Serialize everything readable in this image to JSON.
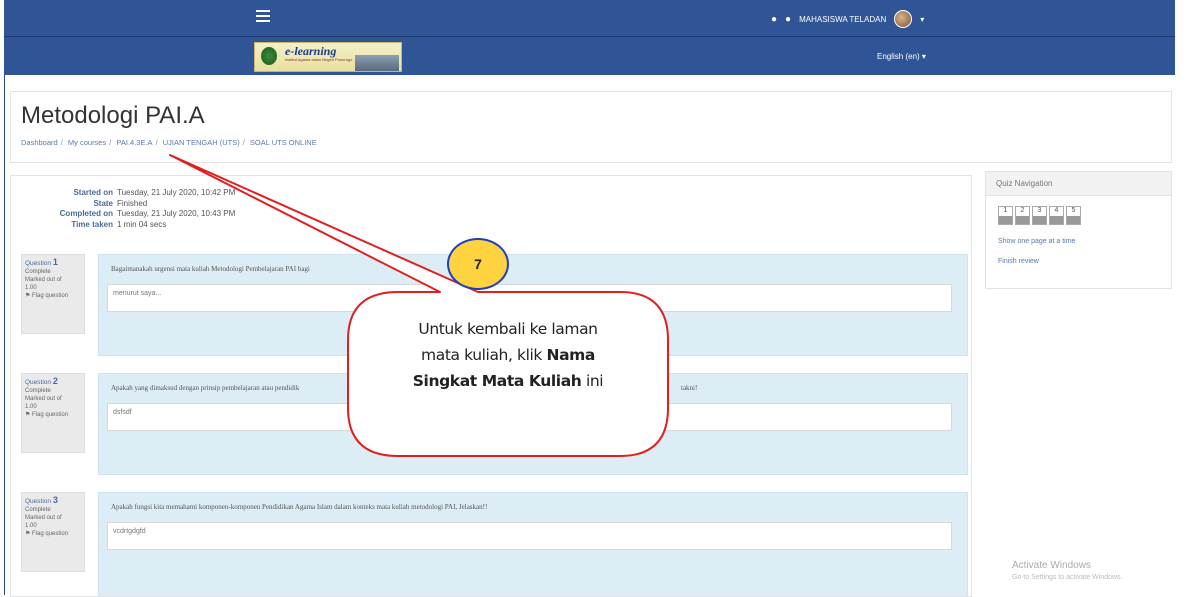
{
  "topbar": {
    "user_name": "MAHASISWA TELADAN",
    "user_caret": "▾",
    "menu_icon": "hamburger-icon",
    "bell_icon": "bell-icon",
    "chat_icon": "chat-icon"
  },
  "banner": {
    "logo_text": "e-learning",
    "logo_subtitle": "Institut Agama Islam Negeri Ponorogo",
    "language": "English (en) ▾"
  },
  "header": {
    "title": "Metodologi PAI.A",
    "breadcrumb": [
      "Dashboard",
      "My courses",
      "PAI.4.3E.A",
      "UJIAN TENGAH (UTS)",
      "SOAL UTS ONLINE"
    ]
  },
  "summary": {
    "rows": [
      {
        "label": "Started on",
        "value": "Tuesday, 21 July 2020, 10:42 PM"
      },
      {
        "label": "State",
        "value": "Finished"
      },
      {
        "label": "Completed on",
        "value": "Tuesday, 21 July 2020, 10:43 PM"
      },
      {
        "label": "Time taken",
        "value": "1 min 04 secs"
      }
    ]
  },
  "questions": [
    {
      "label": "Question",
      "number": "1",
      "status": "Complete",
      "marked": "Marked out of",
      "max": "1.00",
      "flag": "Flag question",
      "text": "Bagaimanakah urgensi mata kuliah Metodologi Pembelajaran PAI bagi",
      "answer": "menurut saya..."
    },
    {
      "label": "Question",
      "number": "2",
      "status": "Complete",
      "marked": "Marked out of",
      "max": "1.00",
      "flag": "Flag question",
      "text": "Apakah yang dimaksud dengan prinsip pembelajaran atau pendidik",
      "text_tail": "takni!",
      "answer": "dsfsdf"
    },
    {
      "label": "Question",
      "number": "3",
      "status": "Complete",
      "marked": "Marked out of",
      "max": "1.00",
      "flag": "Flag question",
      "text": "Apakah fungsi kita memahami komponen-komponen Pendidikan Agama Islam dalam konteks mata kuliah metodologi PAI, Jelaskan!!",
      "answer": "vcdrtgdgfd"
    }
  ],
  "quiz_nav": {
    "title": "Quiz Navigation",
    "buttons": [
      "1",
      "2",
      "3",
      "4",
      "5"
    ],
    "show_one_page": "Show one page at a time",
    "finish_review": "Finish review"
  },
  "callout": {
    "badge": "7",
    "line1": "Untuk kembali ke laman",
    "line2_pre": "mata kuliah, klik ",
    "line2_bold": "Nama",
    "line3_bold": "Singkat Mata Kuliah",
    "line3_post": " ini"
  },
  "watermark": {
    "title": "Activate Windows",
    "subtitle": "Go to Settings to activate Windows."
  },
  "colors": {
    "topbar": "#2f5597",
    "callout_border": "#e02020",
    "badge_fill": "#ffd23f",
    "badge_border": "#1f3fbf",
    "question_bg": "#dcedf5"
  }
}
